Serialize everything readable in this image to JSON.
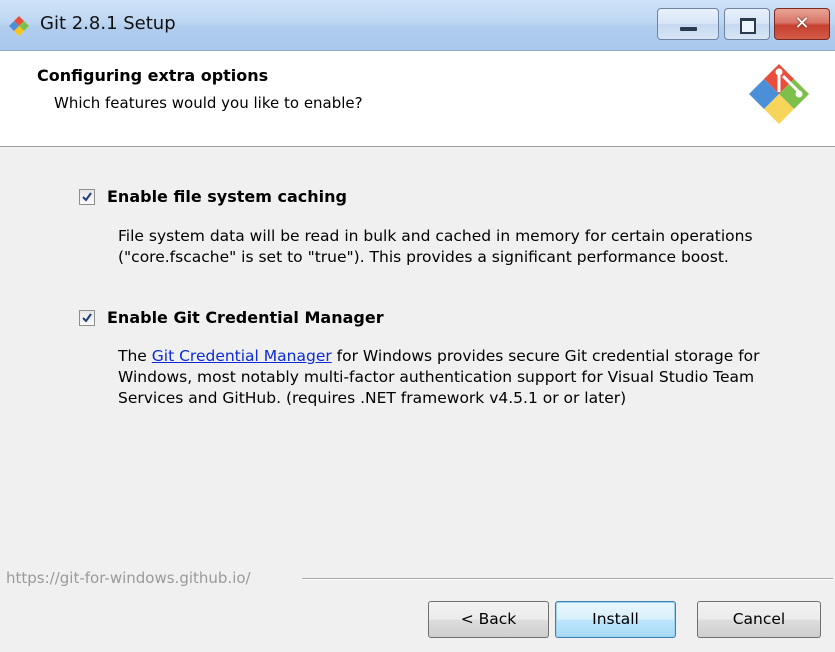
{
  "window": {
    "title": "Git 2.8.1 Setup",
    "close_glyph": "✕"
  },
  "header": {
    "title": "Configuring extra options",
    "subtitle": "Which features would you like to enable?"
  },
  "options": [
    {
      "label": "Enable file system caching",
      "checked": true,
      "description": "File system data will be read in bulk and cached in memory for certain operations (\"core.fscache\" is set to \"true\"). This provides a significant performance boost."
    },
    {
      "label": "Enable Git Credential Manager",
      "checked": true,
      "description_prefix": "The ",
      "description_link": "Git Credential Manager",
      "description_suffix": " for Windows provides secure Git credential storage for Windows, most notably multi-factor authentication support for Visual Studio Team Services and GitHub. (requires .NET framework v4.5.1 or or later)"
    }
  ],
  "footer": {
    "branding": "https://git-for-windows.github.io/",
    "back_label": "< Back",
    "install_label": "Install",
    "cancel_label": "Cancel"
  },
  "colors": {
    "link": "#0a2bd6",
    "install_border": "#3c7fb1",
    "close_button": "#c7402e"
  },
  "icons": [
    "git-logo-icon",
    "minimize-icon",
    "maximize-icon",
    "close-icon",
    "checkmark-icon"
  ]
}
